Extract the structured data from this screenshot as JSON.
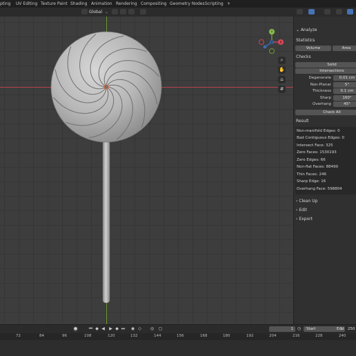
{
  "topbar": {
    "tabs": [
      "pting",
      "UV Editing",
      "Texture Paint",
      "Shading",
      "Animation",
      "Rendering",
      "Compositing",
      "Geometry Nodes",
      "Scripting",
      "+"
    ]
  },
  "header": {
    "transform_orientation": "Global"
  },
  "viewport": {
    "gizmo": {
      "x": "X",
      "y": "Y",
      "z": "Z"
    },
    "nav_icons": [
      "zoom-icon",
      "pan-hand-icon",
      "camera-icon",
      "grid-icon"
    ]
  },
  "panel": {
    "title": "Analyze",
    "statistics_label": "Statistics",
    "tab_volume": "Volume",
    "tab_area": "Area",
    "checks_label": "Checks",
    "solid_button": "Solid",
    "intersections_button": "Intersections",
    "checks": [
      {
        "label": "Degenerate",
        "value": "0.01 cm"
      },
      {
        "label": "Non-Planar",
        "value": "5°"
      },
      {
        "label": "Thickness",
        "value": "0.1 cm"
      },
      {
        "label": "Sharp",
        "value": "160°"
      },
      {
        "label": "Overhang",
        "value": "45°"
      }
    ],
    "check_all_button": "Check All",
    "result_label": "Result",
    "results": [
      "Non-manifold Edges: 0",
      "Bad Contiguous Edges: 0",
      "Intersect Face: 325",
      "Zero Faces: 1530193",
      "Zero Edges: 66",
      "Non-flat Faces: 88490",
      "Thin Faces: 246",
      "Sharp Edge: 16",
      "Overhang Face: 598804"
    ],
    "sections": [
      "Clean Up",
      "Edit",
      "Export"
    ]
  },
  "timeline": {
    "current_frame": "1",
    "start_label": "Start",
    "start_value": "1",
    "end_label": "End",
    "end_value": "250"
  },
  "ruler": {
    "ticks": [
      "72",
      "84",
      "96",
      "108",
      "120",
      "132",
      "144",
      "156",
      "168",
      "180",
      "192",
      "204",
      "216",
      "228",
      "240"
    ]
  }
}
